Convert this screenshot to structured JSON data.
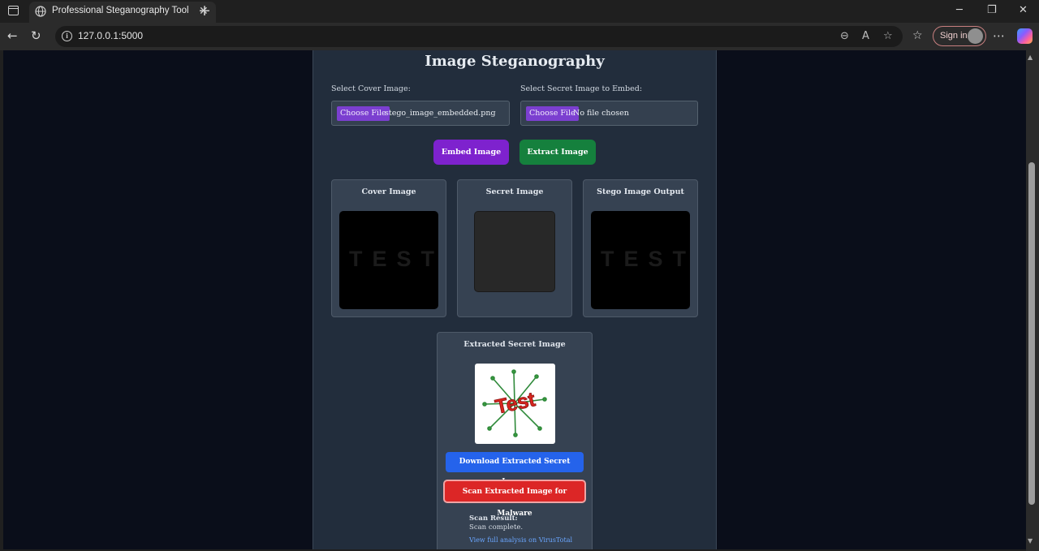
{
  "browser": {
    "tab_title": "Professional Steganography Tool",
    "tab_close": "✕",
    "new_tab": "+",
    "url": "127.0.0.1:5000",
    "sign_in": "Sign in",
    "window_controls": {
      "minimize": "─",
      "maximize": "❐",
      "close": "✕"
    },
    "icons": {
      "back": "arrow-left-icon",
      "reload": "reload-icon",
      "info": "info-icon",
      "zoom": "zoom-icon",
      "read_aloud": "read-aloud-icon",
      "favorite": "star-icon",
      "favorites": "favorites-icon",
      "more": "more-icon",
      "copilot": "copilot-icon"
    }
  },
  "page": {
    "title": "Image Steganography",
    "cover_input": {
      "label": "Select Cover Image:",
      "button": "Choose File",
      "value": "stego_image_embedded.png"
    },
    "secret_input": {
      "label": "Select Secret Image to Embed:",
      "button": "Choose File",
      "value": "No file chosen"
    },
    "buttons": {
      "embed": "Embed Image",
      "extract": "Extract Image"
    },
    "cards": {
      "cover": {
        "title": "Cover Image",
        "image_text": "TEST"
      },
      "secret": {
        "title": "Secret Image"
      },
      "stego": {
        "title": "Stego Image Output",
        "image_text": "TEST"
      }
    },
    "extracted": {
      "title": "Extracted Secret Image",
      "image_text": "Test",
      "download_button": "Download Extracted Secret Image",
      "scan_button": "Scan Extracted Image for Malware",
      "scan_label": "Scan Result:",
      "scan_status": "Scan complete.",
      "scan_link": "View full analysis on VirusTotal"
    }
  },
  "colors": {
    "page_bg": "#0a0e1a",
    "panel_bg": "#222d3c",
    "embed_button": "#7e22ce",
    "extract_button": "#15803d",
    "download_button": "#2563eb",
    "scan_button": "#dc2626",
    "link": "#6aa6ff"
  }
}
